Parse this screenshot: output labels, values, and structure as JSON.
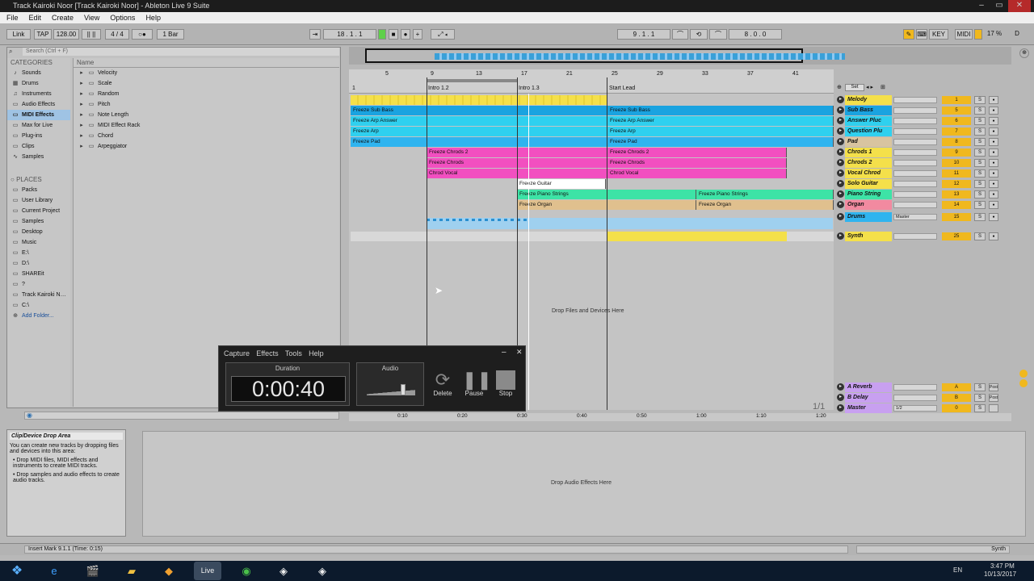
{
  "window": {
    "title": "Track Kairoki Noor  [Track Kairoki Noor] - Ableton Live 9 Suite",
    "min": "–",
    "max": "▭",
    "close": "✕"
  },
  "menu": [
    "File",
    "Edit",
    "Create",
    "View",
    "Options",
    "Help"
  ],
  "transport": {
    "link": "Link",
    "tap": "TAP",
    "bpm": "128.00",
    "sig": "4 / 4",
    "quant": "1 Bar",
    "pos": "18 . 1 . 1",
    "loop_start": "9 . 1 . 1",
    "loop_len": "8 . 0 . 0",
    "key": "KEY",
    "midi": "MIDI",
    "cpu": "17 %",
    "d": "D"
  },
  "browser": {
    "search_placeholder": "Search (Ctrl + F)",
    "categories_header": "CATEGORIES",
    "name_header": "Name",
    "categories": [
      "Sounds",
      "Drums",
      "Instruments",
      "Audio Effects",
      "MIDI Effects",
      "Max for Live",
      "Plug-ins",
      "Clips",
      "Samples"
    ],
    "places_header": "PLACES",
    "places": [
      "Packs",
      "User Library",
      "Current Project",
      "Samples",
      "Desktop",
      "Music",
      "E:\\",
      "D:\\",
      "SHAREit",
      "?",
      "Track Kairoki N…",
      "C:\\",
      "Add Folder..."
    ],
    "items": [
      "Velocity",
      "Scale",
      "Random",
      "Pitch",
      "Note Length",
      "MIDI Effect Rack",
      "Chord",
      "Arpeggiator"
    ]
  },
  "ruler": {
    "bars": [
      "5",
      "9",
      "13",
      "17",
      "21",
      "25",
      "29",
      "33",
      "37",
      "41"
    ],
    "locators": [
      "Intro 1.2",
      "Intro 1.3",
      "Start Lead"
    ],
    "start": "1"
  },
  "clips": [
    {
      "label": "Freeze Sub Bass",
      "row": 1,
      "seg": 0
    },
    {
      "label": "Freeze Sub Bass",
      "row": 1,
      "seg": 1
    },
    {
      "label": "Freeze Arp Answer",
      "row": 2,
      "seg": 0
    },
    {
      "label": "Freeze Arp Answer",
      "row": 2,
      "seg": 1
    },
    {
      "label": "Freeze Arp",
      "row": 3,
      "seg": 0
    },
    {
      "label": "Freeze Arp",
      "row": 3,
      "seg": 1
    },
    {
      "label": "Freeze Pad",
      "row": 4,
      "seg": 0
    },
    {
      "label": "Freeze Pad",
      "row": 4,
      "seg": 1
    },
    {
      "label": "Freeze Chrods 2",
      "row": 5,
      "seg": 0
    },
    {
      "label": "Freeze Chrods 2",
      "row": 5,
      "seg": 1
    },
    {
      "label": "Freeze Chrods",
      "row": 6,
      "seg": 0
    },
    {
      "label": "Freeze Chrods",
      "row": 6,
      "seg": 1
    },
    {
      "label": "Chrod Vocal",
      "row": 7,
      "seg": 0
    },
    {
      "label": "Chrod Vocal",
      "row": 7,
      "seg": 1
    },
    {
      "label": "Freeze Guitar",
      "row": 8,
      "seg": 0
    },
    {
      "label": "Freeze Piano Strings",
      "row": 9,
      "seg": 0
    },
    {
      "label": "Freeze Piano Strings",
      "row": 9,
      "seg": 1
    },
    {
      "label": "Freeze Organ",
      "row": 10,
      "seg": 0
    },
    {
      "label": "Freeze Organ",
      "row": 10,
      "seg": 1
    }
  ],
  "tracks": [
    {
      "name": "Melody",
      "num": "1",
      "color": "#f4e04a"
    },
    {
      "name": "Sub Bass",
      "num": "5",
      "color": "#1aa3e0"
    },
    {
      "name": "Answer Pluc",
      "num": "6",
      "color": "#2fd0ef"
    },
    {
      "name": "Question Plu",
      "num": "7",
      "color": "#2fd0ef"
    },
    {
      "name": "Pad",
      "num": "8",
      "color": "#d8c4a0"
    },
    {
      "name": "Chrods 1",
      "num": "9",
      "color": "#f4e04a"
    },
    {
      "name": "Chrods 2",
      "num": "10",
      "color": "#f4e04a"
    },
    {
      "name": "Vocal Chrod",
      "num": "11",
      "color": "#f4e04a"
    },
    {
      "name": "Solo Guitar",
      "num": "12",
      "color": "#f4e04a"
    },
    {
      "name": "Piano String",
      "num": "13",
      "color": "#3de3a6"
    },
    {
      "name": "Organ",
      "num": "14",
      "color": "#f28aa0"
    },
    {
      "name": "Drums",
      "num": "15",
      "color": "#2fb4ef",
      "route": "Master"
    },
    {
      "name": "Synth",
      "num": "25",
      "color": "#f4e04a"
    }
  ],
  "returns": [
    {
      "name": "A Reverb",
      "num": "A",
      "post": "Post"
    },
    {
      "name": "B Delay",
      "num": "B",
      "post": "Post"
    },
    {
      "name": "Master",
      "num": "0",
      "route": "1/2"
    }
  ],
  "drop_files": "Drop Files and Devices Here",
  "drop_fx": "Drop Audio Effects Here",
  "set_btn": "Set",
  "page_indicator": "1/1",
  "time_ruler": [
    "0:10",
    "0:20",
    "0:30",
    "0:40",
    "0:50",
    "1:00",
    "1:10",
    "1:20"
  ],
  "info": {
    "title": "Clip/Device Drop Area",
    "lines": [
      "You can create new tracks by dropping files and devices into this area:",
      "• Drop MIDI files, MIDI effects and instruments to create MIDI tracks.",
      "• Drop samples and audio effects to create audio tracks."
    ]
  },
  "status": {
    "text": "Insert Mark 9.1.1 (Time: 0:15)",
    "right": "Synth"
  },
  "recorder": {
    "menu": [
      "Capture",
      "Effects",
      "Tools",
      "Help"
    ],
    "duration_label": "Duration",
    "duration": "0:00:40",
    "audio_label": "Audio",
    "level": 0.7,
    "delete": "Delete",
    "pause": "Pause",
    "stop": "Stop"
  },
  "taskbar": {
    "lang": "EN",
    "time": "3:47 PM",
    "date": "10/13/2017",
    "apps": [
      "start-icon",
      "ie-icon",
      "movie-icon",
      "folder-icon",
      "ftp-icon",
      "live-icon",
      "chrome-icon",
      "app-icon",
      "app2-icon"
    ]
  }
}
